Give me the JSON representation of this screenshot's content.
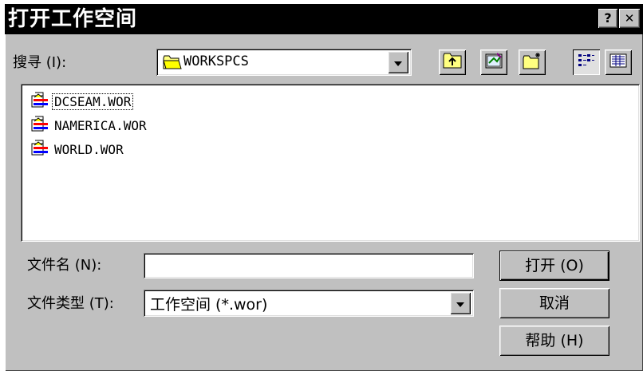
{
  "window": {
    "title": "打开工作空间",
    "help_glyph": "?",
    "close_glyph": "✕"
  },
  "look_in": {
    "label": "搜寻 (I):",
    "value": "WORKSPCS",
    "icon": "folder-icon"
  },
  "toolbar": {
    "items": [
      "up-folder-icon",
      "desktop-icon",
      "new-folder-icon",
      "list-view-icon",
      "details-view-icon"
    ]
  },
  "files": [
    {
      "name": "DCSEAM.WOR",
      "icon": "workspace-file-icon",
      "focused": true
    },
    {
      "name": "NAMERICA.WOR",
      "icon": "workspace-file-icon",
      "focused": false
    },
    {
      "name": "WORLD.WOR",
      "icon": "workspace-file-icon",
      "focused": false
    }
  ],
  "filename": {
    "label": "文件名 (N):",
    "value": ""
  },
  "filetype": {
    "label": "文件类型 (T):",
    "value": "工作空间  (*.wor)"
  },
  "buttons": {
    "open": "打开 (O)",
    "cancel": "取消",
    "help": "帮助 (H)"
  },
  "colors": {
    "face": "#c0c0c0",
    "titlebar": "#000000",
    "window": "#ffffff"
  }
}
